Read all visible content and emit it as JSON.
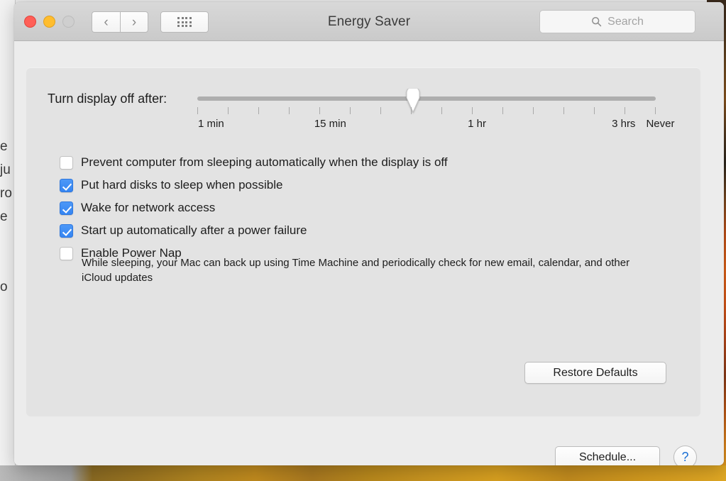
{
  "window": {
    "title": "Energy Saver",
    "traffic_lights": [
      {
        "name": "close",
        "color": "#ff5f57",
        "enabled": true
      },
      {
        "name": "minimize",
        "color": "#ffbd2e",
        "enabled": true
      },
      {
        "name": "zoom",
        "color": "#cfcfcf",
        "enabled": false
      }
    ],
    "nav": {
      "back": "‹",
      "forward": "›"
    },
    "grid_button": "show-all-grid"
  },
  "search": {
    "placeholder": "Search",
    "value": "",
    "icon": "search-icon"
  },
  "slider": {
    "label": "Turn display off after:",
    "tick_labels": [
      {
        "text": "1 min",
        "pos_pct": 3
      },
      {
        "text": "15 min",
        "pos_pct": 29
      },
      {
        "text": "1 hr",
        "pos_pct": 61
      },
      {
        "text": "3 hrs",
        "pos_pct": 93
      },
      {
        "text": "Never",
        "pos_pct": 101
      }
    ],
    "tick_count": 16,
    "thumb_pos_pct": 47,
    "value": "between 15 min and 1 hr"
  },
  "options": [
    {
      "label": "Prevent computer from sleeping automatically when the display is off",
      "checked": false,
      "name": "prevent-sleep"
    },
    {
      "label": "Put hard disks to sleep when possible",
      "checked": true,
      "name": "hard-disk-sleep"
    },
    {
      "label": "Wake for network access",
      "checked": true,
      "name": "wake-network"
    },
    {
      "label": "Start up automatically after a power failure",
      "checked": true,
      "name": "restart-power-failure"
    },
    {
      "label": "Enable Power Nap",
      "checked": false,
      "name": "power-nap"
    }
  ],
  "power_nap_description": "While sleeping, your Mac can back up using Time Machine and periodically check for new email, calendar, and other iCloud updates",
  "buttons": {
    "restore_defaults": "Restore Defaults",
    "schedule": "Schedule...",
    "help": "?"
  },
  "background": {
    "text_fragments": [
      "e",
      "ju",
      "ro",
      "e",
      "o"
    ]
  },
  "colors": {
    "accent_blue": "#3585f2",
    "help_blue": "#1a6fd4",
    "window_bg": "#ececec",
    "panel_bg": "#e3e3e3",
    "titlebar_bg": "#d0d0d0"
  }
}
